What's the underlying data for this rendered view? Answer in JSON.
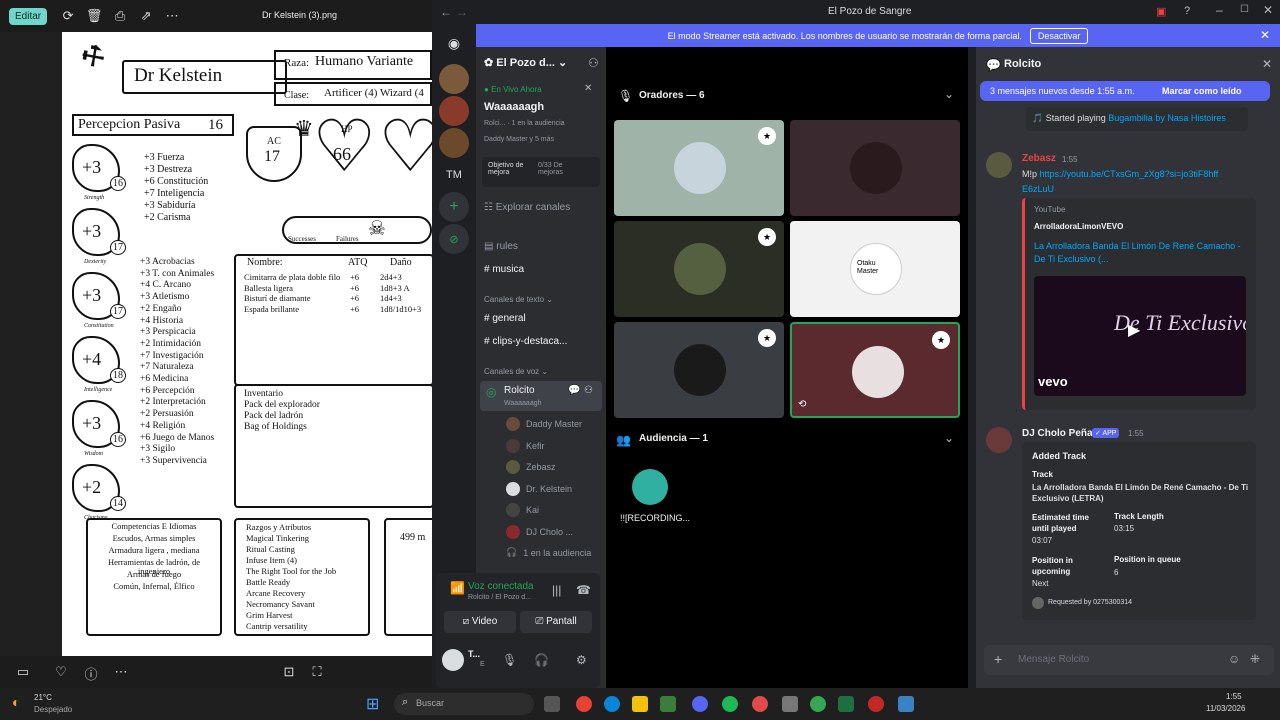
{
  "photos": {
    "toolbar": {
      "edit_label": "Editar",
      "icons": [
        "rotate-icon",
        "delete-icon",
        "print-icon",
        "share-icon",
        "more-icon"
      ]
    },
    "file_title": "Dr Kelstein (3).png",
    "bottom_icons": [
      "film-strip-icon",
      "heart-icon",
      "info-icon",
      "more-icon",
      "fit-icon",
      "fullscreen-icon"
    ]
  },
  "sheet": {
    "name": "Dr Kelstein",
    "race_label": "Raza:",
    "race": "Humano Variante",
    "class_label": "Clase:",
    "class": "Artificer (4) Wizard (4",
    "passive": "Percepcion Pasiva",
    "passive_val": "16",
    "ac_label": "AC",
    "ac": "17",
    "hp_label": "HP",
    "hp": "66",
    "successes": "Successes",
    "failures": "Failures",
    "abilities": [
      {
        "mod": "+3",
        "score": "16",
        "label": "Strength"
      },
      {
        "mod": "+3",
        "score": "17",
        "label": "Dexterity"
      },
      {
        "mod": "+3",
        "score": "17",
        "label": "Constitution"
      },
      {
        "mod": "+4",
        "score": "18",
        "label": "Intelligence"
      },
      {
        "mod": "+3",
        "score": "16",
        "label": "Wisdom"
      },
      {
        "mod": "+2",
        "score": "14",
        "label": "Charisma"
      }
    ],
    "saves": [
      "+3 Fuerza",
      "+3 Destreza",
      "+6 Constitución",
      "+7 Inteligencia",
      "+3 Sabiduría",
      "+2 Carisma"
    ],
    "skills": [
      "+3 Acrobacias",
      "+3 T. con Animales",
      "+4 C. Arcano",
      "+3 Atletismo",
      "+2 Engaño",
      "+4 Historia",
      "+3 Perspicacia",
      "+2 Intimidación",
      "+7 Investigación",
      "+7 Naturaleza",
      "+6 Medicina",
      "+6 Percepción",
      "+2 Interpretación",
      "+2 Persuasión",
      "+4 Religión",
      "+6 Juego de Manos",
      "+3 Sigilo",
      "+3 Supervivencia"
    ],
    "attacks_headers": [
      "Nombre:",
      "ATQ",
      "Daño"
    ],
    "attacks": [
      [
        "Cimitarra de plata doble filo",
        "+6",
        "2d4+3"
      ],
      [
        "Ballesta ligera",
        "+6",
        "1d8+3 A"
      ],
      [
        "Bisturí de diamante",
        "+6",
        "1d4+3"
      ],
      [
        "Espada brillante",
        "+6",
        "1d8/1d10+3"
      ]
    ],
    "inventory": [
      "Inventario",
      "Pack del explorador",
      "Pack del ladrón",
      "Bag of Holdings"
    ],
    "profs": [
      "Competencias E Idiomas",
      "Escudos, Armas simples",
      "Armadura ligera , mediana",
      "Herramientas de ladrón, de ingeniero",
      "Armas de fuego",
      "Común, Infernal, Élfico"
    ],
    "traits": [
      "Razgos y Atributos",
      "Magical Tinkering",
      "Ritual Casting",
      "Infuse Item (4)",
      "The Right Tool for the Job",
      "Battle Ready",
      "Arcane Recovery",
      "Necromancy Savant",
      "Grim Harvest",
      "Cantrip versatility"
    ],
    "money": "499 m"
  },
  "discord": {
    "window_title": "El Pozo de Sangre",
    "streamer_text": "El modo Streamer está activado. Los nombres de usuario se mostrarán de forma parcial.",
    "streamer_button": "Desactivar",
    "server_name": "El Pozo d...",
    "live_label": "En Vivo Ahora",
    "live_title": "Waaaaaagh",
    "live_detail_1": "Rolci...",
    "live_audience": "1 en la audiencia",
    "live_detail_2": "Daddy Master y 5 más",
    "boost_label": "Objetivo de mejora",
    "boost_val": "0/33 De mejoras",
    "explore": "Explorar canales",
    "channels_top": [
      "rules",
      "musica"
    ],
    "text_category": "Canales de texto",
    "text_channels": [
      "general",
      "clips-y-destaca..."
    ],
    "voice_category": "Canales de voz",
    "voice_channel": "Rolcito",
    "voice_status": "Waaaaaagh",
    "voice_users": [
      "Daddy Master",
      "Kefir",
      "Zebasz",
      "Dr. Kelstein",
      "Kai",
      "DJ Cholo ..."
    ],
    "voice_audience": "1 en la audiencia",
    "connected": "Voz conectada",
    "connected_sub": "Rolcito / El Pozo d...",
    "video_btn": "Video",
    "screen_btn": "Pantall",
    "user_short": "T...",
    "user_sub": "E",
    "speakers_header": "Oradores — 6",
    "audience_header": "Audiencia — 1",
    "audience_user": "!![RECORDING...",
    "tile_colors": [
      "#9fb3a8",
      "#3a2a30",
      "#2a2e25",
      "#f2f2f2",
      "#3a3d42",
      "#5a2a2f"
    ],
    "tile_text_4": "Otaku Master",
    "chat_title": "Rolcito",
    "new_msgs": "3 mensajes nuevos desde 1:55 a.m.",
    "mark_read": "Marcar como leído",
    "msg0_prefix": "Started playing ",
    "msg0_link": "Bugambilia by Nasa Histoires",
    "msg1_name": "Zebasz",
    "msg1_time": "1:55",
    "msg1_cmd": "M!p",
    "msg1_url": "https://youtu.be/CTxsGm_zXg8?si=jo3tiF8hffE6zLuU",
    "embed_provider": "YouTube",
    "embed_author": "ArrolladoraLimonVEVO",
    "embed_title": "La Arrolladora Banda El Limón De René Camacho - De Ti Exclusivo (...",
    "embed_image_text": "De Ti Exclusivo",
    "embed_vevo": "vevo",
    "msg2_name": "DJ Cholo Peña",
    "msg2_badge": "APP",
    "msg2_time": "1:55",
    "track_heading": "Added Track",
    "track_label": "Track",
    "track_name": "La Arrolladora Banda El Limón De René Camacho - De Ti Exclusivo (LETRA)",
    "est_label": "Estimated time until played",
    "est_val": "03:07",
    "len_label": "Track Length",
    "len_val": "03:15",
    "pos_up_label": "Position in upcoming",
    "pos_up_val": "Next",
    "pos_q_label": "Position in queue",
    "pos_q_val": "6",
    "requested": "Requested by 0275300314",
    "input_placeholder": "Mensaje Rolcito",
    "colors": {
      "blurple": "#5865f2",
      "green": "#23a55a",
      "red": "#ed4245",
      "link": "#00a8fc"
    }
  },
  "taskbar": {
    "temp": "21°C",
    "weather": "Despejado",
    "search": "Buscar",
    "time": "1:55",
    "date": "11/03/2026"
  }
}
